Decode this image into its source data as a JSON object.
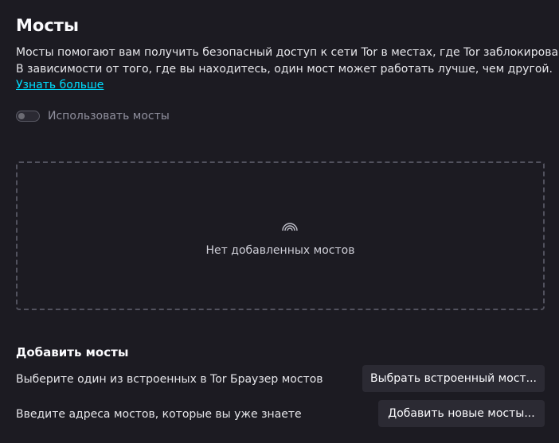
{
  "section": {
    "title": "Мосты",
    "description_line1": "Мосты помогают вам получить безопасный доступ к сети Tor в местах, где Tor заблокирован.",
    "description_line2": "В зависимости от того, где вы находитесь, один мост может работать лучше, чем другой.",
    "learn_more": "Узнать больше"
  },
  "toggle": {
    "label": "Использовать мосты",
    "enabled": false
  },
  "empty_state": {
    "icon": "bridge-icon",
    "text": "Нет добавленных мостов"
  },
  "add": {
    "title": "Добавить мосты",
    "builtin_label": "Выберите один из встроенных в Tor Браузер мостов",
    "builtin_button": "Выбрать встроенный мост...",
    "new_label": "Введите адреса мостов, которые вы уже знаете",
    "new_button": "Добавить новые мосты..."
  },
  "colors": {
    "background": "#1c1b22",
    "link": "#00ddff",
    "button": "#2b2a33"
  }
}
